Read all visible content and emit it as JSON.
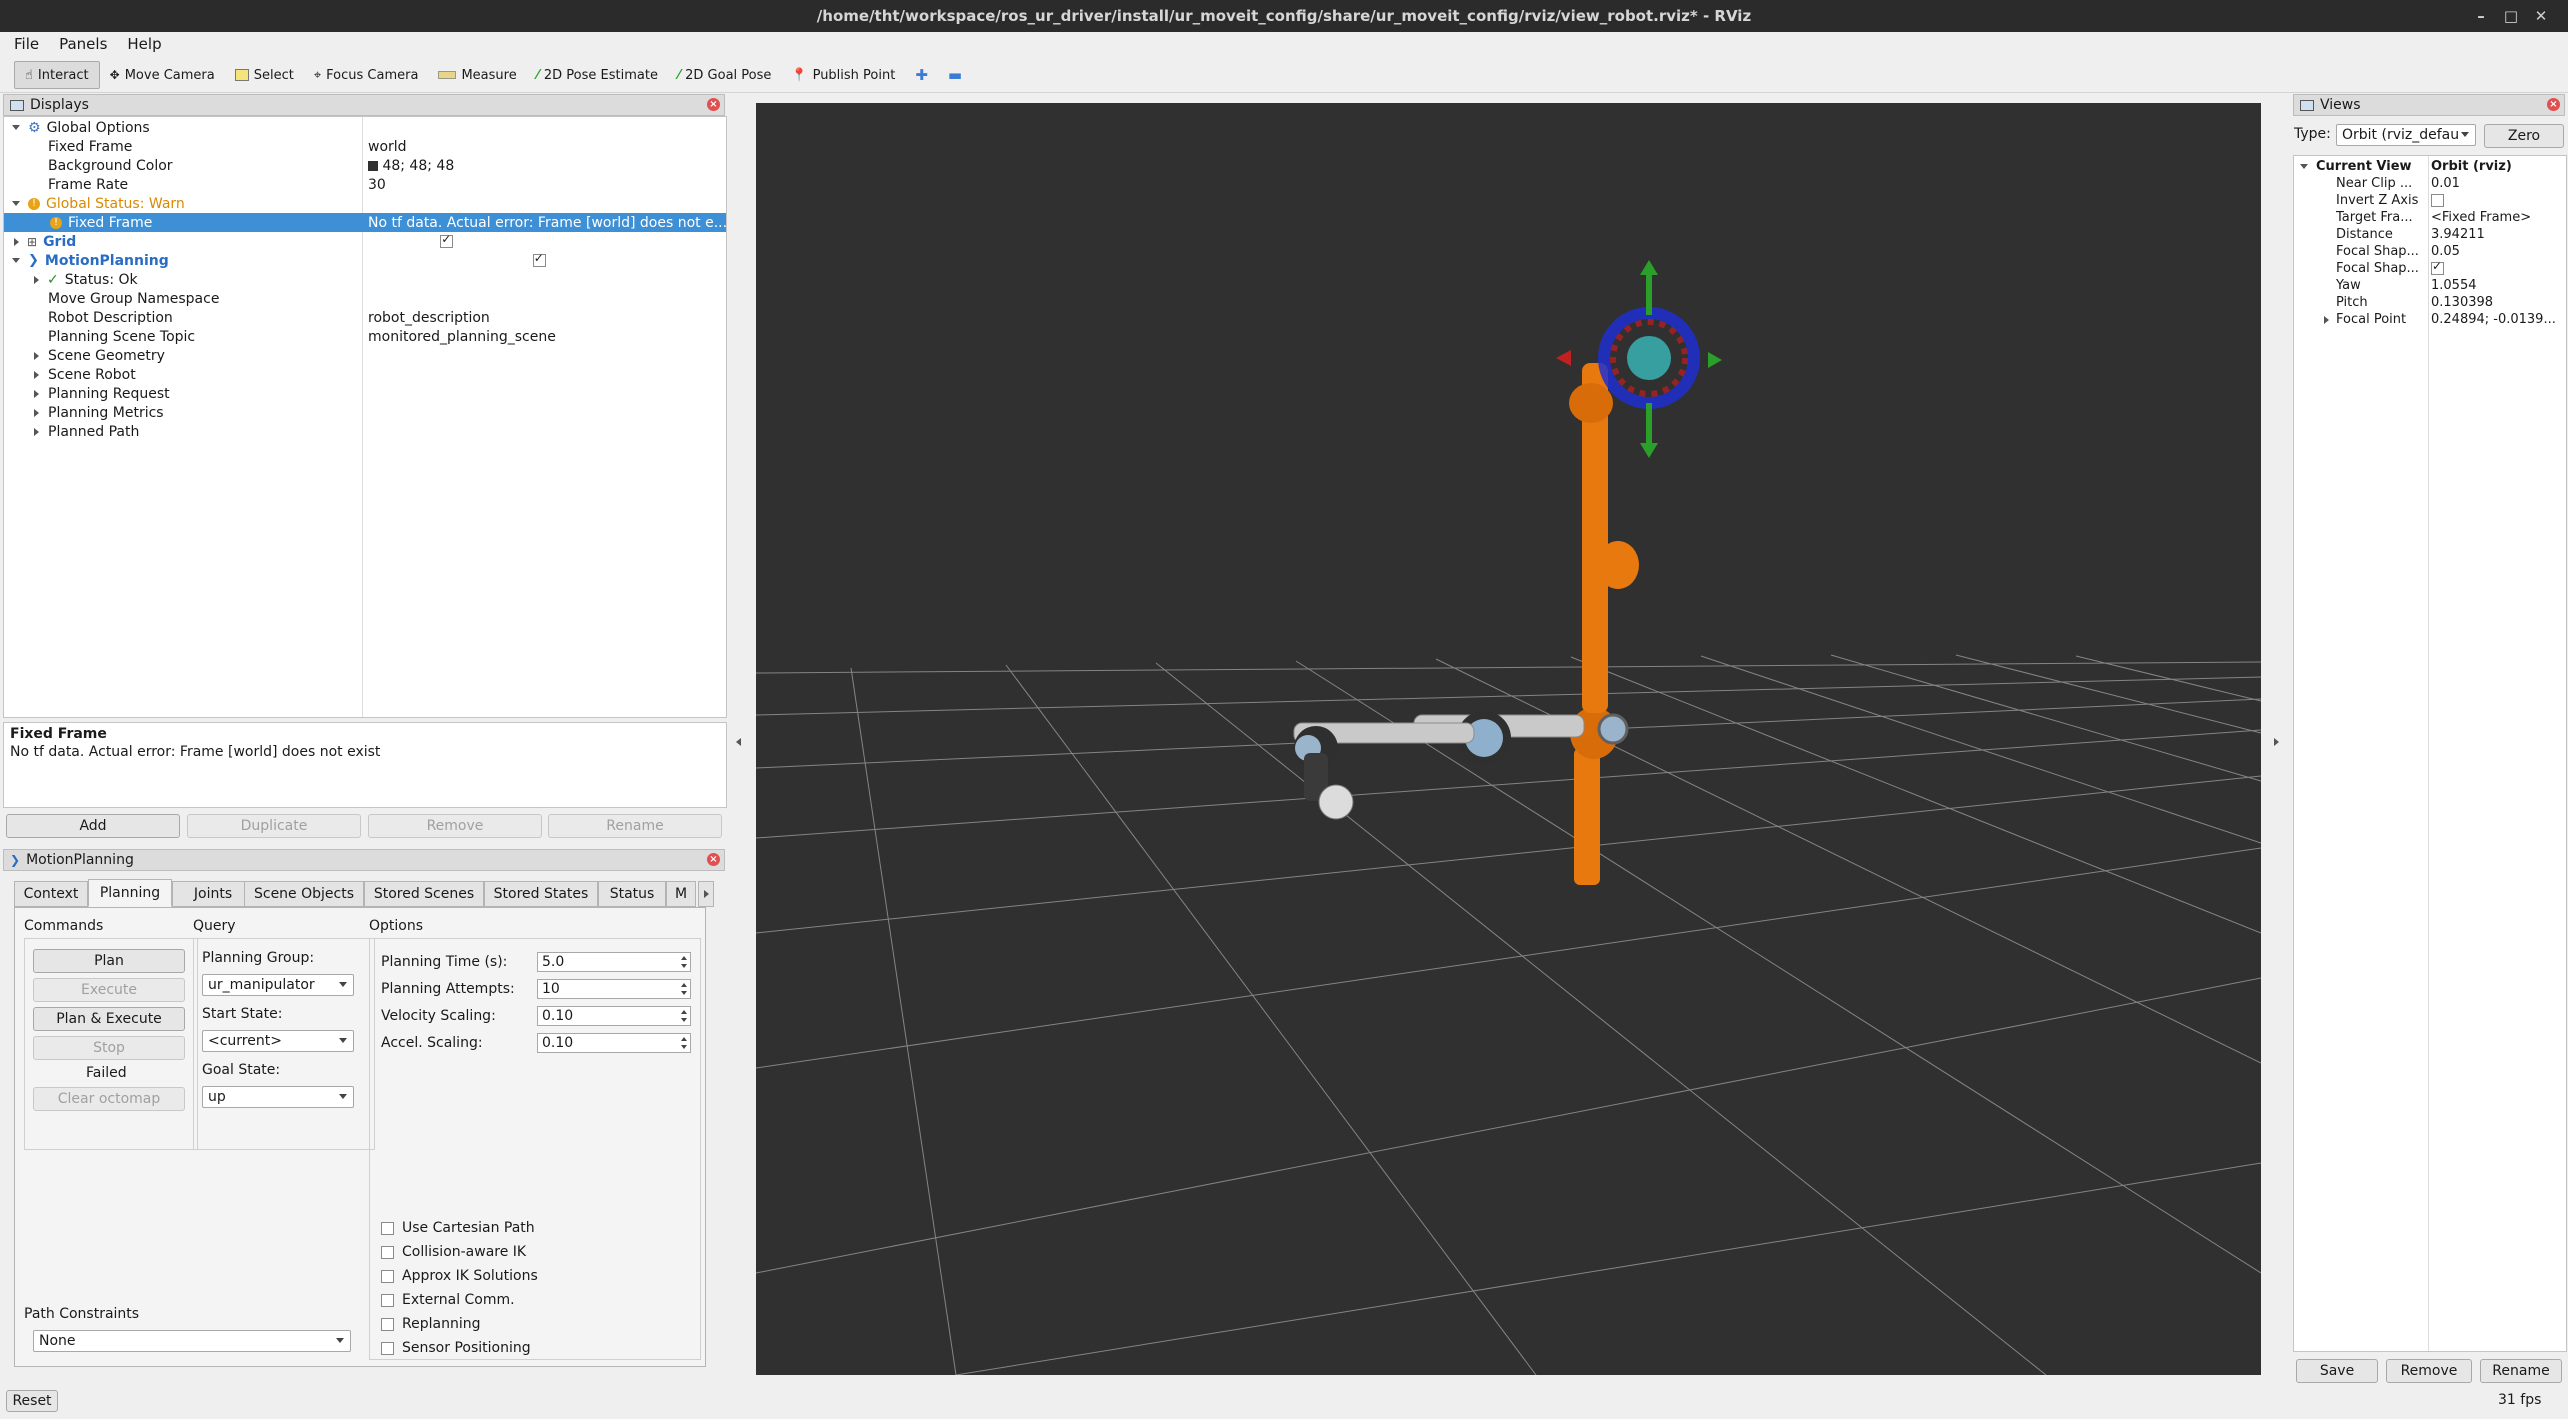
{
  "window": {
    "title": "/home/tht/workspace/ros_ur_driver/install/ur_moveit_config/share/ur_moveit_config/rviz/view_robot.rviz* - RViz"
  },
  "menu": {
    "file": "File",
    "panels": "Panels",
    "help": "Help"
  },
  "toolbar": {
    "interact": "Interact",
    "move_camera": "Move Camera",
    "select": "Select",
    "focus_camera": "Focus Camera",
    "measure": "Measure",
    "pose_estimate": "2D Pose Estimate",
    "goal_pose": "2D Goal Pose",
    "publish_point": "Publish Point"
  },
  "displays": {
    "title": "Displays",
    "global_options": "Global Options",
    "fixed_frame_label": "Fixed Frame",
    "fixed_frame_value": "world",
    "background_color_label": "Background Color",
    "background_color_value": "48; 48; 48",
    "frame_rate_label": "Frame Rate",
    "frame_rate_value": "30",
    "global_status": "Global Status: Warn",
    "status_fixed_frame": "Fixed Frame",
    "status_fixed_frame_value": "No tf data.  Actual error: Frame [world] does not e...",
    "grid": "Grid",
    "motion_planning": "MotionPlanning",
    "status_ok": "Status: Ok",
    "move_group_ns": "Move Group Namespace",
    "robot_description_label": "Robot Description",
    "robot_description_value": "robot_description",
    "planning_scene_topic_label": "Planning Scene Topic",
    "planning_scene_topic_value": "monitored_planning_scene",
    "scene_geometry": "Scene Geometry",
    "scene_robot": "Scene Robot",
    "planning_request": "Planning Request",
    "planning_metrics": "Planning Metrics",
    "planned_path": "Planned Path",
    "desc_title": "Fixed Frame",
    "desc_text": "No tf data. Actual error: Frame [world] does not exist",
    "btn_add": "Add",
    "btn_duplicate": "Duplicate",
    "btn_remove": "Remove",
    "btn_rename": "Rename"
  },
  "motion_planning_panel": {
    "title": "MotionPlanning",
    "tabs": [
      "Context",
      "Planning",
      "Joints",
      "Scene Objects",
      "Stored Scenes",
      "Stored States",
      "Status",
      "M"
    ],
    "commands_label": "Commands",
    "plan": "Plan",
    "execute": "Execute",
    "plan_execute": "Plan & Execute",
    "stop": "Stop",
    "status": "Failed",
    "clear_octomap": "Clear octomap",
    "query_label": "Query",
    "planning_group_label": "Planning Group:",
    "planning_group_value": "ur_manipulator",
    "start_state_label": "Start State:",
    "start_state_value": "<current>",
    "goal_state_label": "Goal State:",
    "goal_state_value": "up",
    "options_label": "Options",
    "planning_time_label": "Planning Time (s):",
    "planning_time_value": "5.0",
    "planning_attempts_label": "Planning Attempts:",
    "planning_attempts_value": "10",
    "velocity_scaling_label": "Velocity Scaling:",
    "velocity_scaling_value": "0.10",
    "accel_scaling_label": "Accel. Scaling:",
    "accel_scaling_value": "0.10",
    "use_cartesian": "Use Cartesian Path",
    "collision_ik": "Collision-aware IK",
    "approx_ik": "Approx IK Solutions",
    "external_comm": "External Comm.",
    "replanning": "Replanning",
    "sensor_positioning": "Sensor Positioning",
    "path_constraints_label": "Path Constraints",
    "path_constraints_value": "None"
  },
  "views": {
    "title": "Views",
    "type_label": "Type:",
    "type_value": "Orbit (rviz_defau",
    "zero": "Zero",
    "current_view": "Current View",
    "current_view_value": "Orbit (rviz)",
    "near_clip_label": "Near Clip ...",
    "near_clip_value": "0.01",
    "invert_z_label": "Invert Z Axis",
    "target_frame_label": "Target Fra...",
    "target_frame_value": "<Fixed Frame>",
    "distance_label": "Distance",
    "distance_value": "3.94211",
    "focal_shape1_label": "Focal Shap...",
    "focal_shape1_value": "0.05",
    "focal_shape2_label": "Focal Shap...",
    "yaw_label": "Yaw",
    "yaw_value": "1.0554",
    "pitch_label": "Pitch",
    "pitch_value": "0.130398",
    "focal_point_label": "Focal Point",
    "focal_point_value": "0.24894; -0.0139...",
    "btn_save": "Save",
    "btn_remove": "Remove",
    "btn_rename": "Rename"
  },
  "statusbar": {
    "reset": "Reset",
    "fps": "31 fps"
  },
  "colors": {
    "viewport_bg": "#303030",
    "robot_orange": "#e8790e",
    "selection": "#3d8fd6",
    "warn": "#d98a00"
  }
}
